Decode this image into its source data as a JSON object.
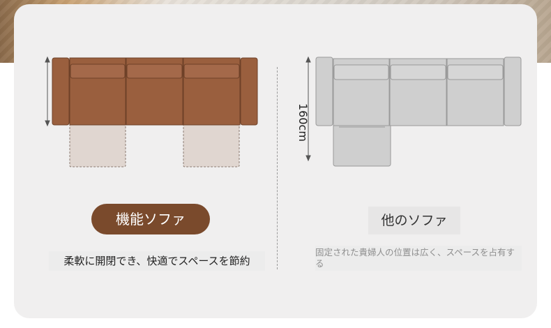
{
  "functional_sofa": {
    "label": "機能ソファ",
    "description": "柔軟に開閉でき、快適でスペースを節約"
  },
  "other_sofa": {
    "label": "他のソファ",
    "description": "固定された貴婦人の位置は広く、スペースを占有する",
    "depth_label": "160cm"
  },
  "colors": {
    "functional_body": "#9a5f3e",
    "functional_pill": "#7a4a2c",
    "footrest_fill": "#e0d6d0",
    "other_body": "#cfcfcf",
    "card": "#f0efef"
  }
}
